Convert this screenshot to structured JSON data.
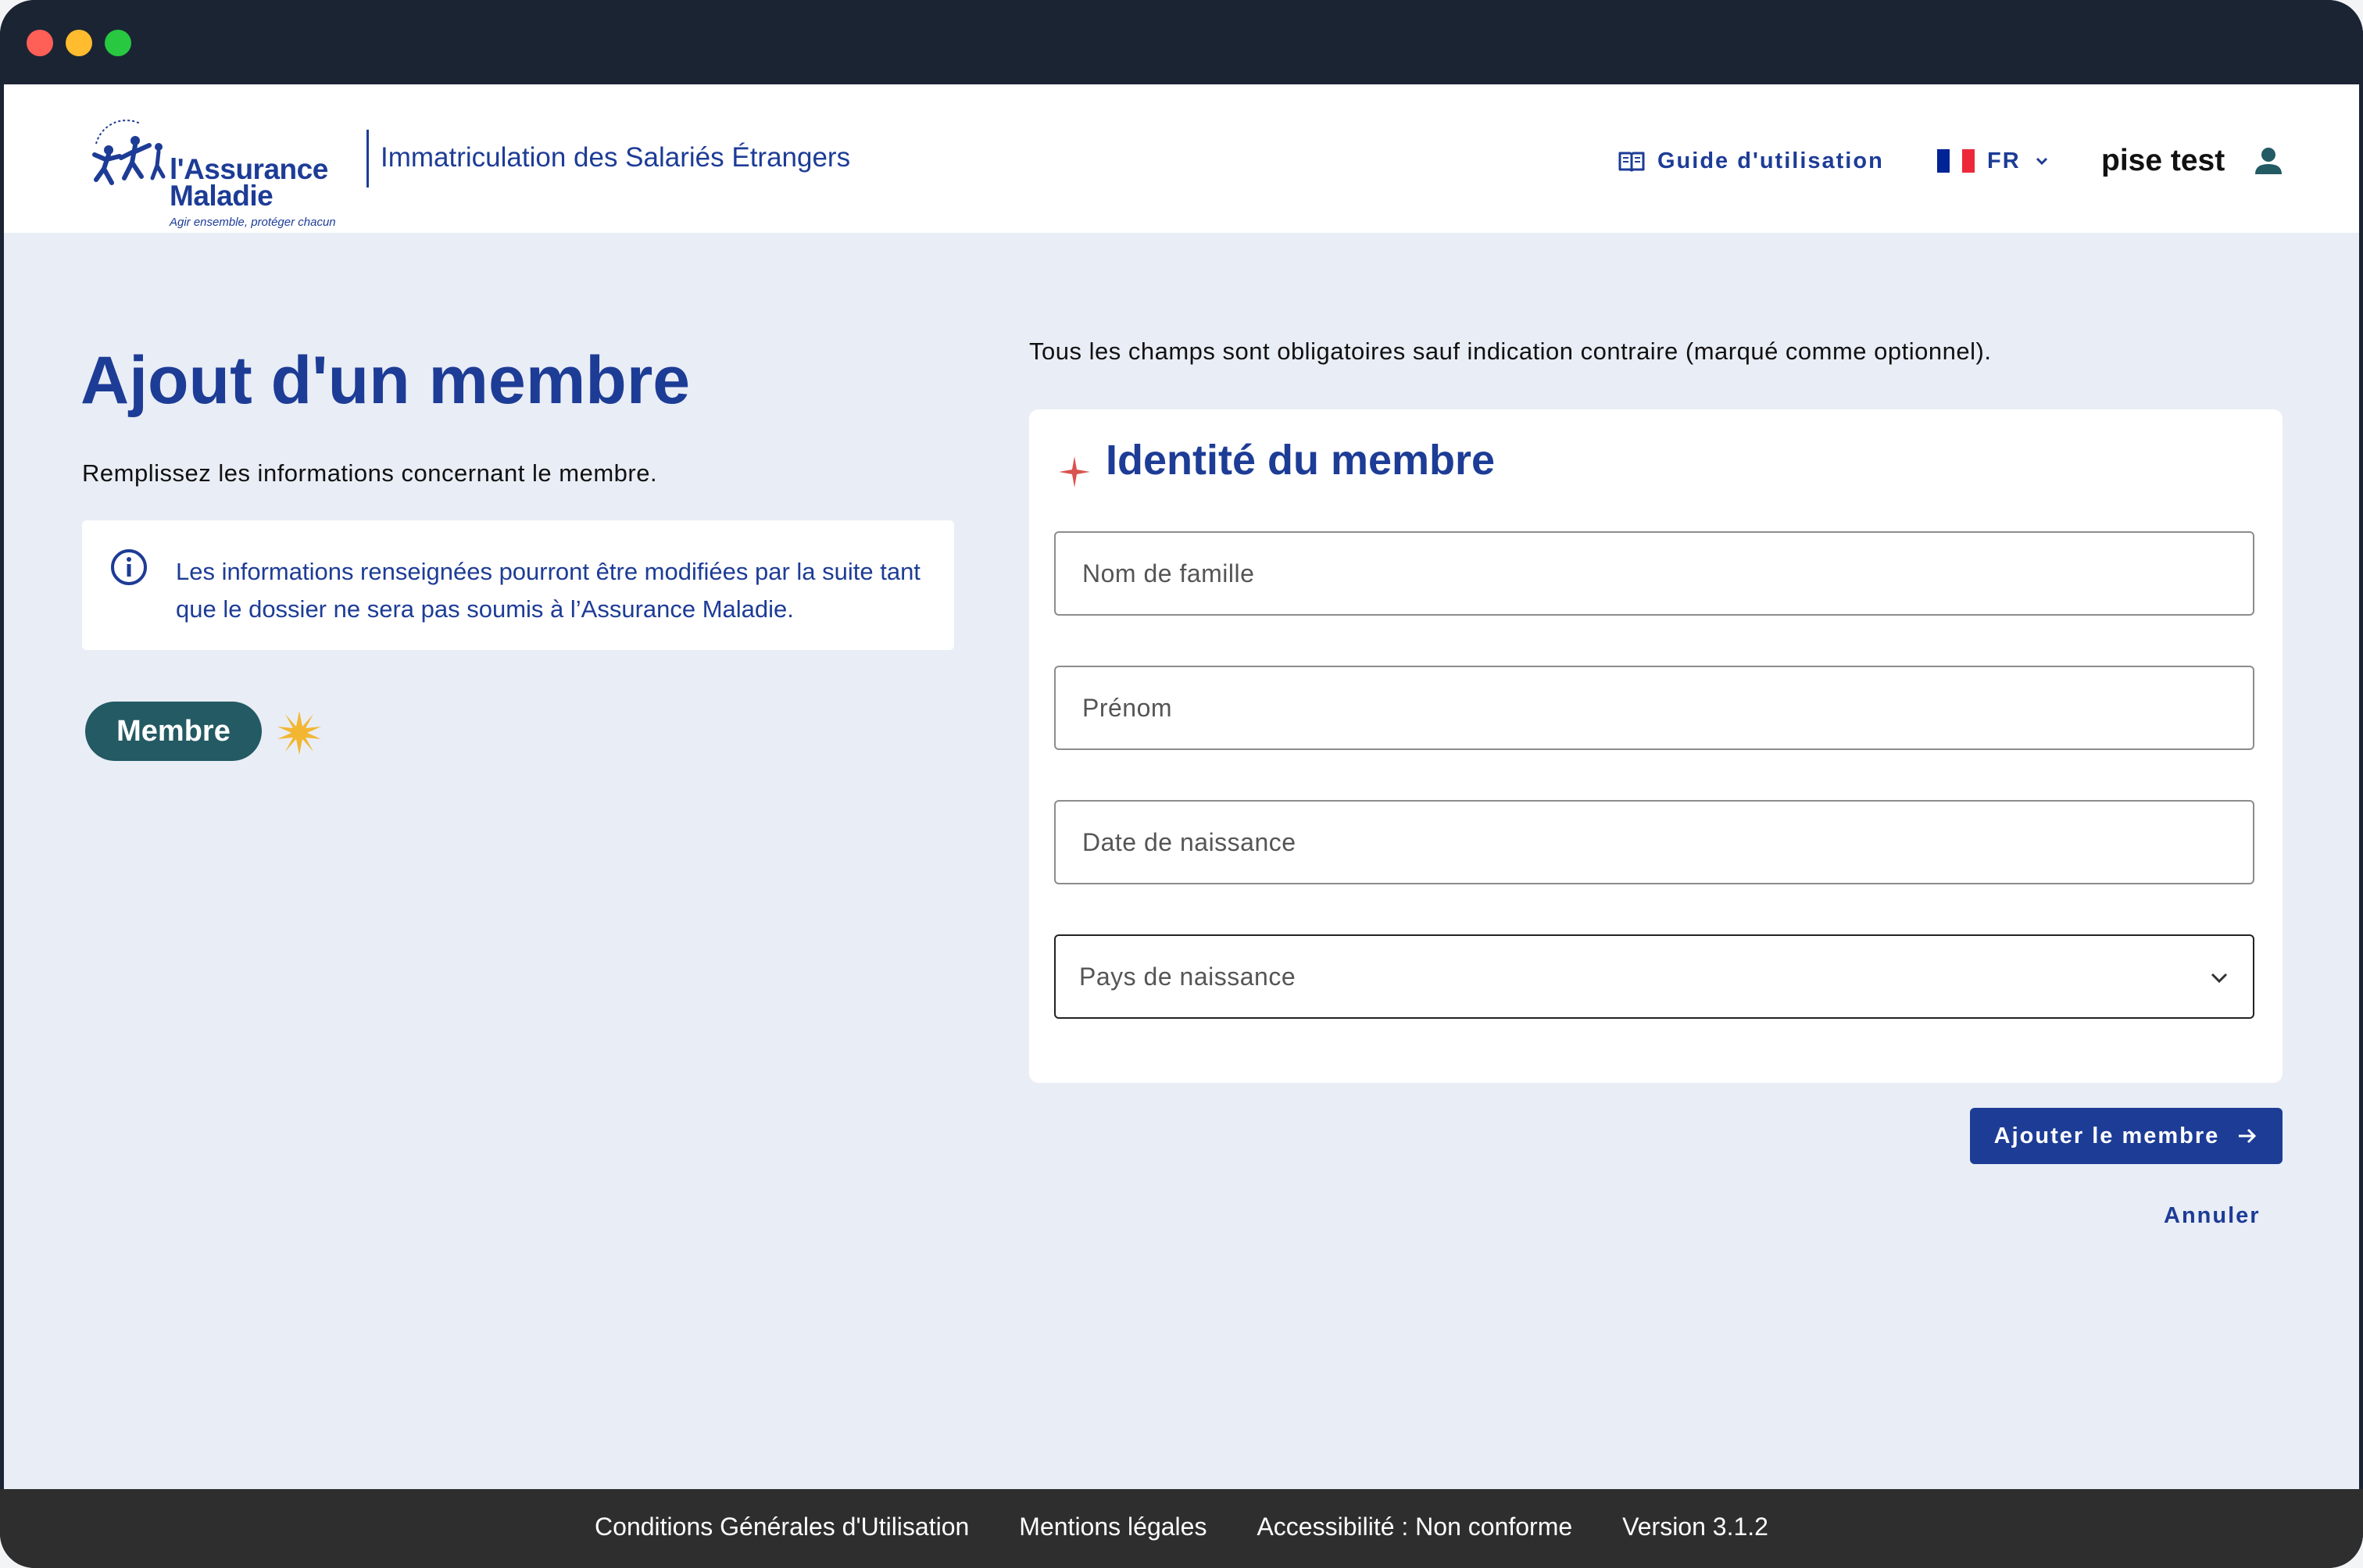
{
  "window": {
    "controls": [
      "close",
      "minimize",
      "maximize"
    ]
  },
  "header": {
    "logo": {
      "line1": "l'Assurance",
      "line2": "Maladie",
      "tagline": "Agir ensemble, protéger chacun",
      "icon": "assurance-maladie-logo-icon"
    },
    "app_name": "Immatriculation des Salariés Étrangers",
    "guide_label": "Guide d'utilisation",
    "guide_icon": "book-icon",
    "language": {
      "selected": "FR",
      "flag_colors": [
        "#002395",
        "#ffffff",
        "#ed2939"
      ]
    },
    "user_name": "pise test",
    "user_icon": "user-icon"
  },
  "left": {
    "title": "Ajout d'un membre",
    "subtitle": "Remplissez les informations concernant le membre.",
    "info": {
      "icon": "info-icon",
      "text": "Les informations renseignées pourront être modifiées par la suite tant que le dossier ne sera pas soumis à l’Assurance Maladie."
    },
    "chip_label": "Membre",
    "chip_color": "#235a63",
    "sparkle_icon": "sparkle-icon"
  },
  "form": {
    "required_note": "Tous les champs sont obligatoires sauf indication contraire (marqué comme optionnel).",
    "section_title": "Identité du membre",
    "section_icon": "star-icon",
    "fields": {
      "last_name_placeholder": "Nom de famille",
      "first_name_placeholder": "Prénom",
      "birth_date_placeholder": "Date de naissance",
      "birth_country_placeholder": "Pays de naissance"
    },
    "submit_label": "Ajouter le membre",
    "cancel_label": "Annuler"
  },
  "footer": {
    "links": [
      "Conditions Générales d'Utilisation",
      "Mentions légales",
      "Accessibilité : Non conforme",
      "Version 3.1.2"
    ]
  },
  "colors": {
    "brand_blue": "#1d3c96",
    "page_background": "#e9edf5",
    "window_chrome": "#1b2433",
    "footer": "#2e2e2e",
    "accent_red": "#d9534f",
    "sparkle_yellow": "#f2b632"
  }
}
